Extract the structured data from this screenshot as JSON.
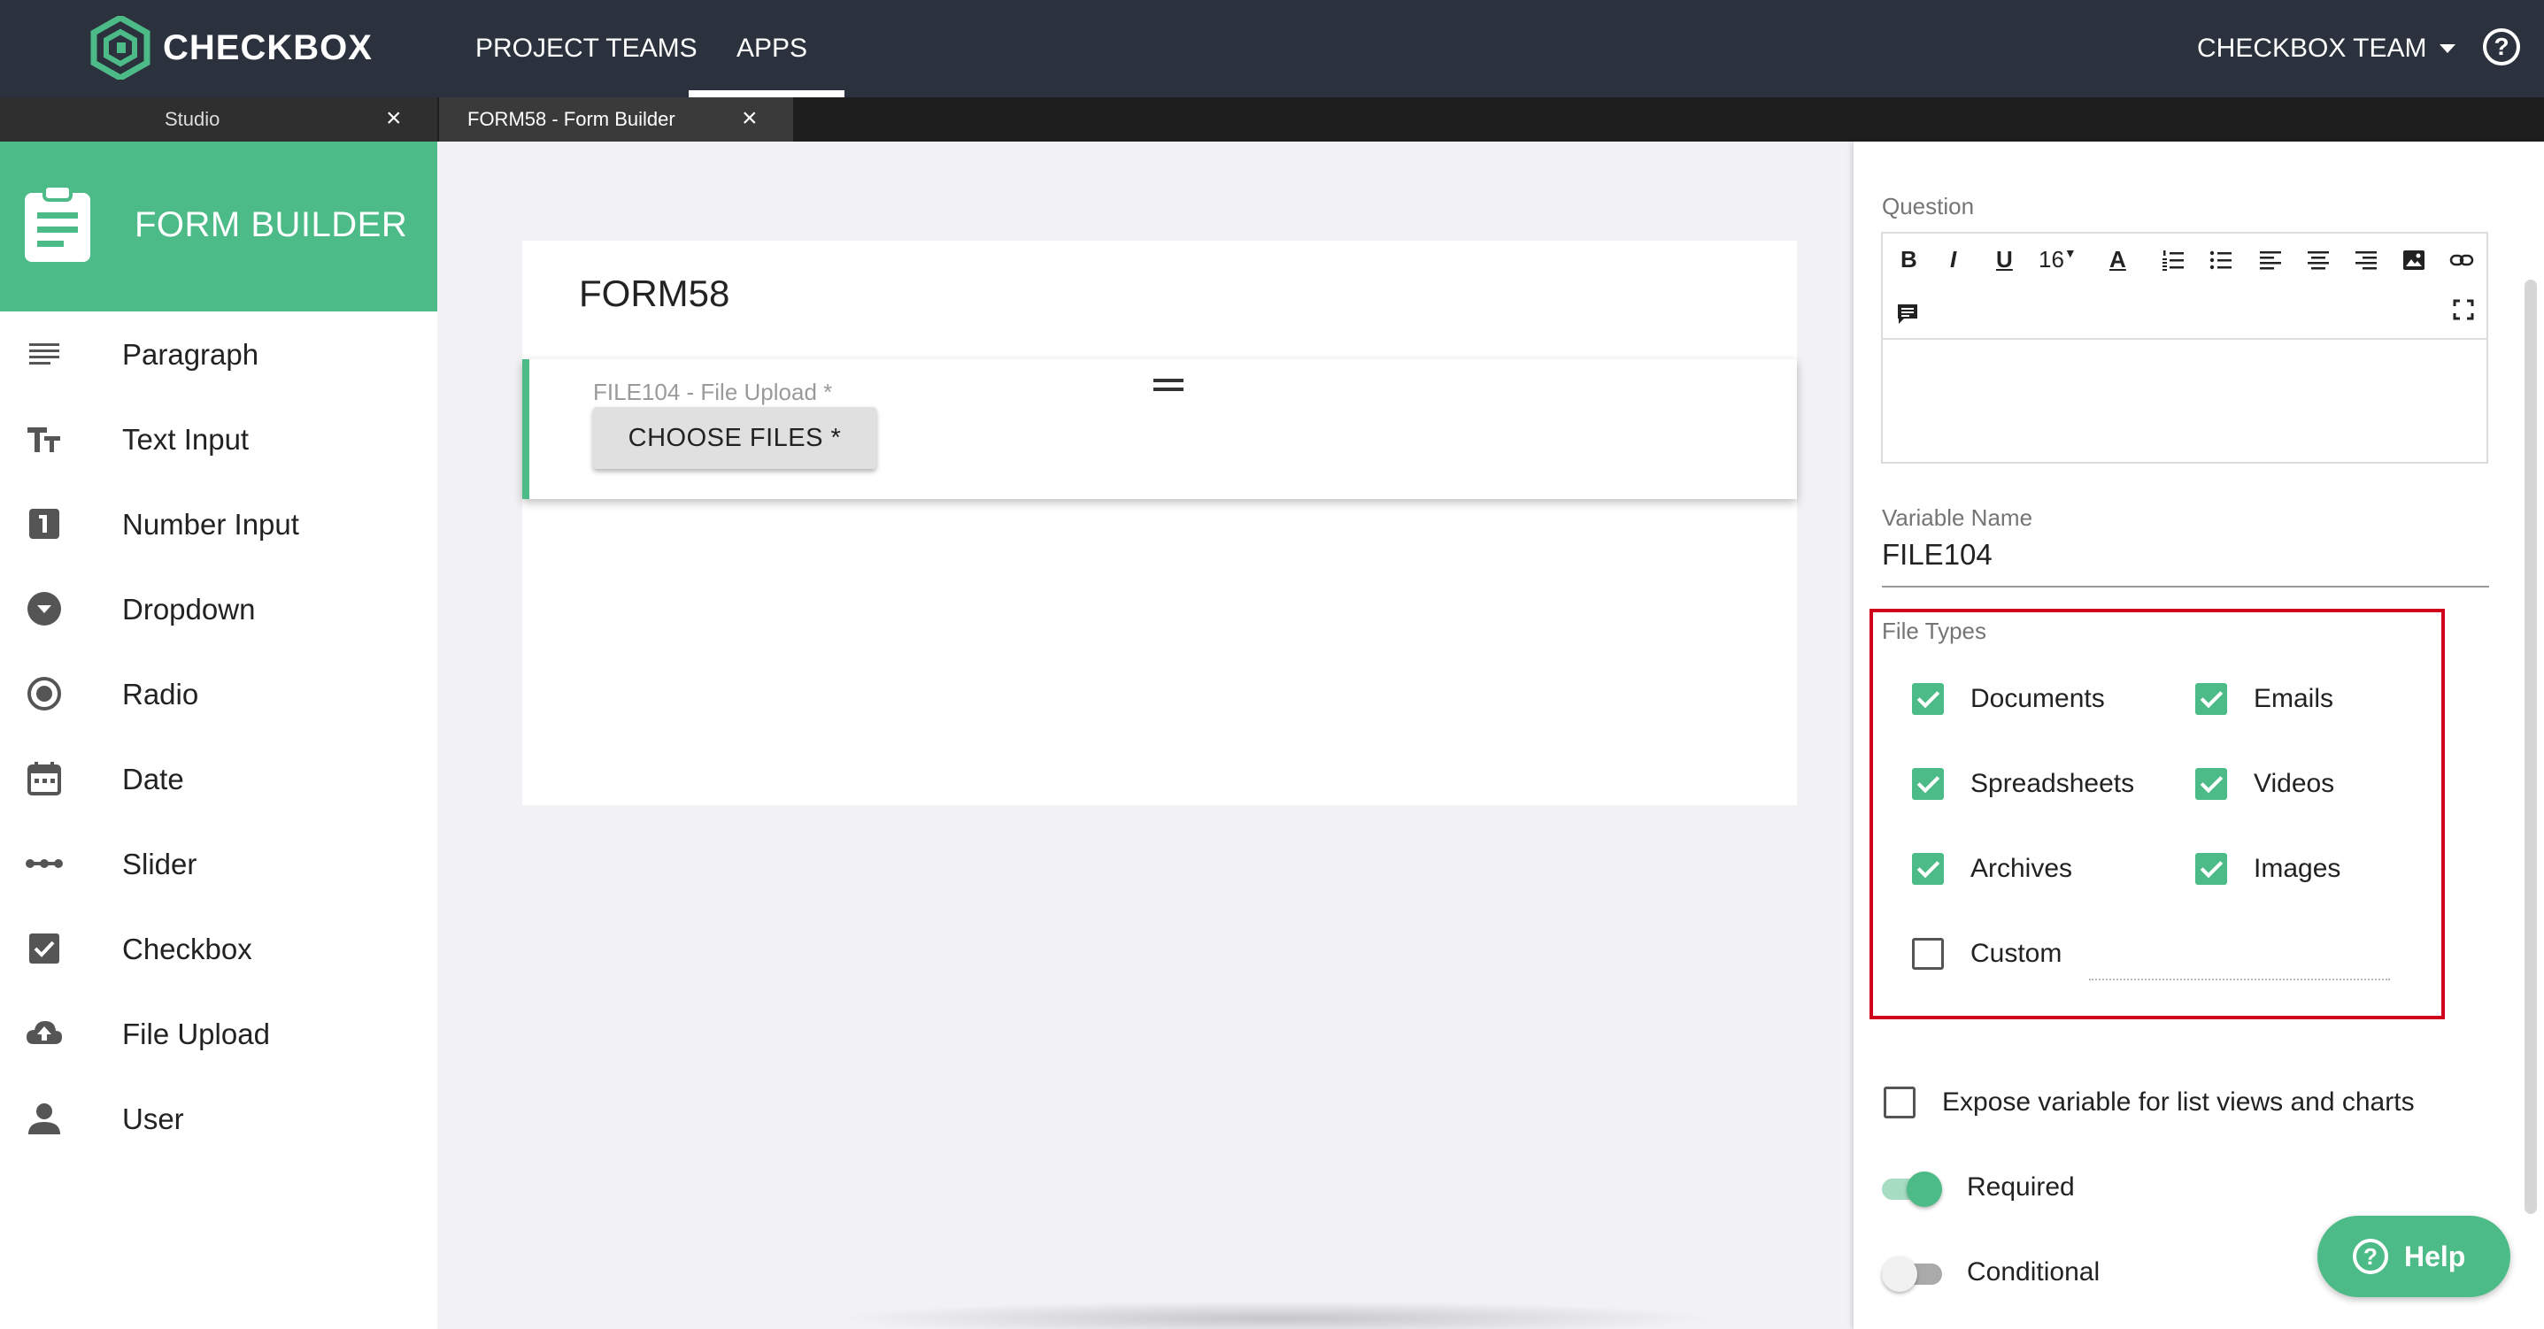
{
  "app": {
    "brand": "CHECKBOX"
  },
  "topnav": {
    "items": [
      "PROJECT TEAMS",
      "APPS"
    ],
    "active": "APPS",
    "team_menu": "CHECKBOX TEAM",
    "help_glyph": "?"
  },
  "tabs": [
    {
      "label": "Studio",
      "close": "×"
    },
    {
      "label": "FORM58 - Form Builder",
      "close": "×",
      "active": true
    }
  ],
  "sidebar": {
    "title": "FORM BUILDER",
    "items": [
      {
        "label": "Paragraph",
        "icon": "paragraph-icon"
      },
      {
        "label": "Text Input",
        "icon": "text-input-icon"
      },
      {
        "label": "Number Input",
        "icon": "number-input-icon"
      },
      {
        "label": "Dropdown",
        "icon": "dropdown-icon"
      },
      {
        "label": "Radio",
        "icon": "radio-icon"
      },
      {
        "label": "Date",
        "icon": "calendar-icon"
      },
      {
        "label": "Slider",
        "icon": "slider-icon"
      },
      {
        "label": "Checkbox",
        "icon": "checkbox-icon"
      },
      {
        "label": "File Upload",
        "icon": "cloud-upload-icon"
      },
      {
        "label": "User",
        "icon": "user-icon"
      }
    ]
  },
  "canvas": {
    "form_title": "FORM58",
    "field": {
      "label": "FILE104 - File Upload *",
      "button_label": "CHOOSE FILES *"
    }
  },
  "properties": {
    "question_label": "Question",
    "toolbar": {
      "bold": "B",
      "italic": "I",
      "underline": "U",
      "font_size": "16",
      "font_color": "A"
    },
    "variable_name_label": "Variable Name",
    "variable_name_value": "FILE104",
    "file_types_label": "File Types",
    "file_types": [
      {
        "label": "Documents",
        "checked": true
      },
      {
        "label": "Emails",
        "checked": true
      },
      {
        "label": "Spreadsheets",
        "checked": true
      },
      {
        "label": "Videos",
        "checked": true
      },
      {
        "label": "Archives",
        "checked": true
      },
      {
        "label": "Images",
        "checked": true
      },
      {
        "label": "Custom",
        "checked": false
      }
    ],
    "expose_label": "Expose variable for list views and charts",
    "expose_checked": false,
    "required_label": "Required",
    "required_on": true,
    "conditional_label": "Conditional",
    "conditional_on": false
  },
  "help_button": {
    "glyph": "?",
    "label": "Help"
  },
  "colors": {
    "accent": "#4dbb87",
    "topbar": "#2b323d",
    "highlight": "#d0021b"
  }
}
